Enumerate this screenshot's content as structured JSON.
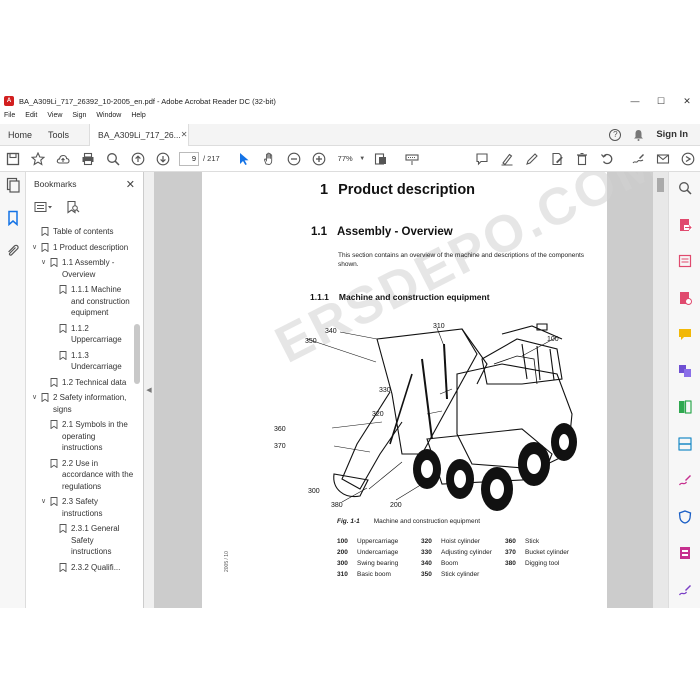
{
  "window": {
    "title": "BA_A309Li_717_26392_10-2005_en.pdf - Adobe Acrobat Reader DC (32-bit)"
  },
  "menu": [
    "File",
    "Edit",
    "View",
    "Sign",
    "Window",
    "Help"
  ],
  "tabs": {
    "home": "Home",
    "tools": "Tools",
    "document": "BA_A309Li_717_26..."
  },
  "account": {
    "sign_in": "Sign In"
  },
  "toolbar": {
    "page_current": "9",
    "page_total": "/ 217",
    "zoom": "77%"
  },
  "bookmarks": {
    "title": "Bookmarks",
    "items": [
      {
        "label": "Table of contents",
        "level": 0,
        "expanded": null
      },
      {
        "label": "1 Product description",
        "level": 0,
        "expanded": true
      },
      {
        "label": "1.1 Assembly - Overview",
        "level": 1,
        "expanded": true
      },
      {
        "label": "1.1.1 Machine and construction equipment",
        "level": 2,
        "expanded": null
      },
      {
        "label": "1.1.2 Uppercarriage",
        "level": 2,
        "expanded": null
      },
      {
        "label": "1.1.3 Undercarriage",
        "level": 2,
        "expanded": null
      },
      {
        "label": "1.2 Technical data",
        "level": 1,
        "expanded": null
      },
      {
        "label": "2 Safety information, signs",
        "level": 0,
        "expanded": true
      },
      {
        "label": "2.1 Symbols in the operating instructions",
        "level": 1,
        "expanded": null
      },
      {
        "label": "2.2 Use in accordance with the regulations",
        "level": 1,
        "expanded": null
      },
      {
        "label": "2.3 Safety instructions",
        "level": 1,
        "expanded": true
      },
      {
        "label": "2.3.1 General Safety instructions",
        "level": 2,
        "expanded": null
      },
      {
        "label": "2.3.2 Qualifi...",
        "level": 2,
        "expanded": null
      }
    ]
  },
  "document": {
    "h1_num": "1",
    "h1": "Product description",
    "h2_num": "1.1",
    "h2": "Assembly - Overview",
    "intro": "This section contains an overview of the machine and descriptions of the components shown.",
    "h3_num": "1.1.1",
    "h3": "Machine and construction equipment",
    "figure_label": "Fig. 1-1",
    "figure_caption": "Machine and construction equipment",
    "callouts": [
      "350",
      "340",
      "310",
      "100",
      "330",
      "320",
      "360",
      "370",
      "380",
      "300",
      "200"
    ],
    "parts": [
      {
        "num": "100",
        "name": "Uppercarriage"
      },
      {
        "num": "200",
        "name": "Undercarriage"
      },
      {
        "num": "300",
        "name": "Swing bearing"
      },
      {
        "num": "310",
        "name": "Basic boom"
      },
      {
        "num": "320",
        "name": "Hoist cylinder"
      },
      {
        "num": "330",
        "name": "Adjusting cylinder"
      },
      {
        "num": "340",
        "name": "Boom"
      },
      {
        "num": "350",
        "name": "Stick cylinder"
      },
      {
        "num": "360",
        "name": "Stick"
      },
      {
        "num": "370",
        "name": "Bucket cylinder"
      },
      {
        "num": "380",
        "name": "Digging tool"
      }
    ],
    "side_text": "2005 / 10",
    "watermark": "ERSDEPO.COM"
  },
  "colors": {
    "accent": "#1473e6",
    "pdf_red": "#d21f1f"
  }
}
